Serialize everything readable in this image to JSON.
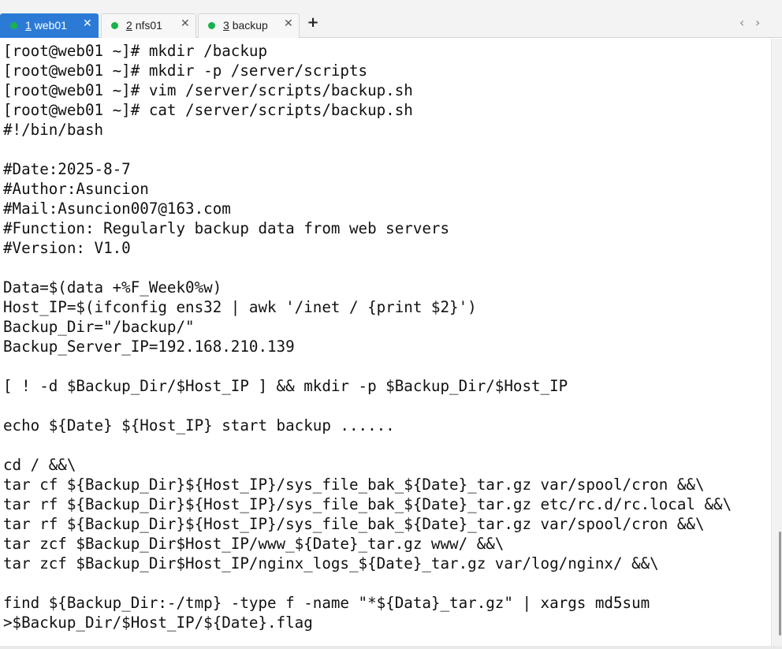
{
  "tabs": [
    {
      "num": "1",
      "name": "web01",
      "active": true
    },
    {
      "num": "2",
      "name": "nfs01",
      "active": false
    },
    {
      "num": "3",
      "name": "backup",
      "active": false
    }
  ],
  "icons": {
    "close": "close-icon",
    "add": "plus-icon",
    "prev": "chevron-left-icon",
    "next": "chevron-right-icon",
    "status": "status-dot-icon"
  },
  "colors": {
    "active_tab": "#2b7bd6",
    "status_dot": "#19b24b"
  },
  "terminal": {
    "lines": [
      "[root@web01 ~]# mkdir /backup",
      "[root@web01 ~]# mkdir -p /server/scripts",
      "[root@web01 ~]# vim /server/scripts/backup.sh",
      "[root@web01 ~]# cat /server/scripts/backup.sh",
      "#!/bin/bash",
      "",
      "#Date:2025-8-7",
      "#Author:Asuncion",
      "#Mail:Asuncion007@163.com",
      "#Function: Regularly backup data from web servers",
      "#Version: V1.0",
      "",
      "Data=$(data +%F_Week0%w)",
      "Host_IP=$(ifconfig ens32 | awk '/inet / {print $2}')",
      "Backup_Dir=\"/backup/\"",
      "Backup_Server_IP=192.168.210.139",
      "",
      "[ ! -d $Backup_Dir/$Host_IP ] && mkdir -p $Backup_Dir/$Host_IP",
      "",
      "echo ${Date} ${Host_IP} start backup ......",
      "",
      "cd / &&\\",
      "tar cf ${Backup_Dir}${Host_IP}/sys_file_bak_${Date}_tar.gz var/spool/cron &&\\",
      "tar rf ${Backup_Dir}${Host_IP}/sys_file_bak_${Date}_tar.gz etc/rc.d/rc.local &&\\",
      "tar rf ${Backup_Dir}${Host_IP}/sys_file_bak_${Date}_tar.gz var/spool/cron &&\\",
      "tar zcf $Backup_Dir$Host_IP/www_${Date}_tar.gz www/ &&\\",
      "tar zcf $Backup_Dir$Host_IP/nginx_logs_${Date}_tar.gz var/log/nginx/ &&\\",
      "",
      "find ${Backup_Dir:-/tmp} -type f -name \"*${Data}_tar.gz\" | xargs md5sum",
      ">$Backup_Dir/$Host_IP/${Date}.flag"
    ]
  }
}
